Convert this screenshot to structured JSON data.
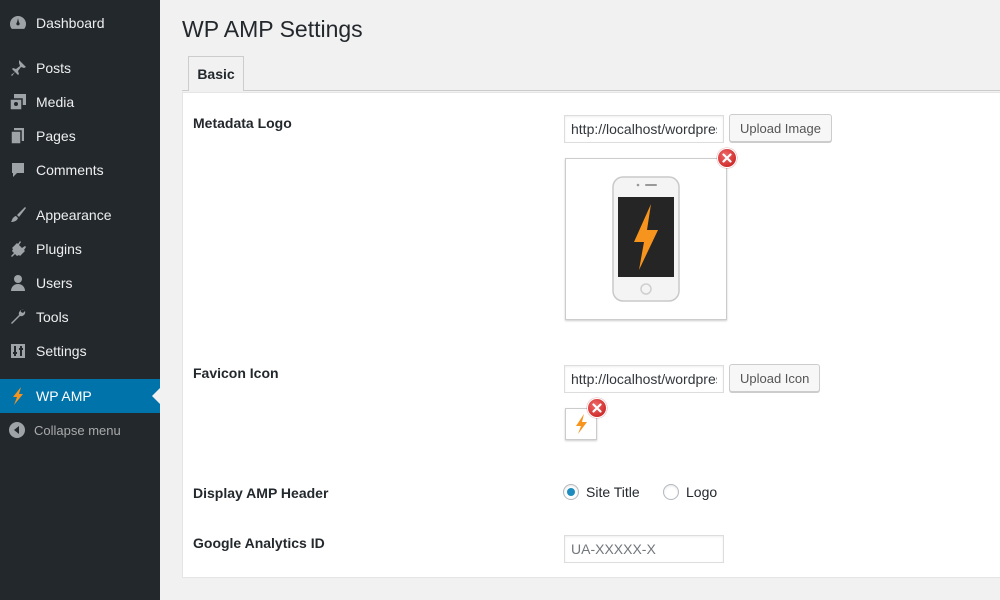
{
  "sidebar": {
    "items": [
      {
        "label": "Dashboard",
        "icon": "dashboard-icon"
      },
      {
        "label": "Posts",
        "icon": "pin-icon"
      },
      {
        "label": "Media",
        "icon": "media-icon"
      },
      {
        "label": "Pages",
        "icon": "pages-icon"
      },
      {
        "label": "Comments",
        "icon": "comment-icon"
      },
      {
        "label": "Appearance",
        "icon": "brush-icon"
      },
      {
        "label": "Plugins",
        "icon": "plug-icon"
      },
      {
        "label": "Users",
        "icon": "user-icon"
      },
      {
        "label": "Tools",
        "icon": "wrench-icon"
      },
      {
        "label": "Settings",
        "icon": "sliders-icon"
      },
      {
        "label": "WP AMP",
        "icon": "bolt-icon",
        "active": true
      }
    ],
    "collapse_label": "Collapse menu"
  },
  "page": {
    "title": "WP AMP Settings",
    "tabs": [
      {
        "label": "Basic",
        "active": true
      }
    ]
  },
  "settings": {
    "metadata_logo": {
      "label": "Metadata Logo",
      "value": "http://localhost/wordpress",
      "button": "Upload Image"
    },
    "favicon": {
      "label": "Favicon Icon",
      "value": "http://localhost/wordpress",
      "button": "Upload Icon"
    },
    "amp_header": {
      "label": "Display AMP Header",
      "options": [
        "Site Title",
        "Logo"
      ],
      "selected": "Site Title"
    },
    "analytics": {
      "label": "Google Analytics ID",
      "placeholder": "UA-XXXXX-X",
      "value": ""
    }
  },
  "colors": {
    "sidebar_bg": "#23282d",
    "active_bg": "#0073aa",
    "bolt_orange": "#f7941d",
    "remove_red": "#d61f1f"
  }
}
